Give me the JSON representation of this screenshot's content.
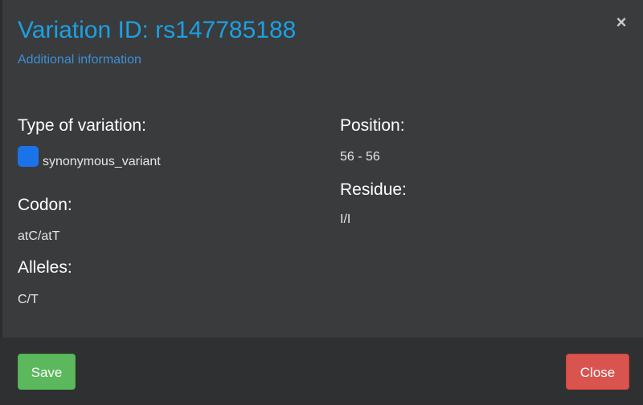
{
  "dialog": {
    "title": "Variation ID: rs147785188",
    "subtitle": "Additional information",
    "close_glyph": "×"
  },
  "details": {
    "type_label": "Type of variation:",
    "type_value": "synonymous_variant",
    "type_color": "#1a73e8",
    "codon_label": "Codon:",
    "codon_value": "atC/atT",
    "alleles_label": "Alleles:",
    "alleles_value": "C/T",
    "position_label": "Position:",
    "position_value": "56 - 56",
    "residue_label": "Residue:",
    "residue_value": "I/I"
  },
  "footer": {
    "save_label": "Save",
    "close_label": "Close"
  },
  "colors": {
    "title": "#1ba1e2",
    "save": "#5cb85c",
    "close": "#d9534f"
  }
}
